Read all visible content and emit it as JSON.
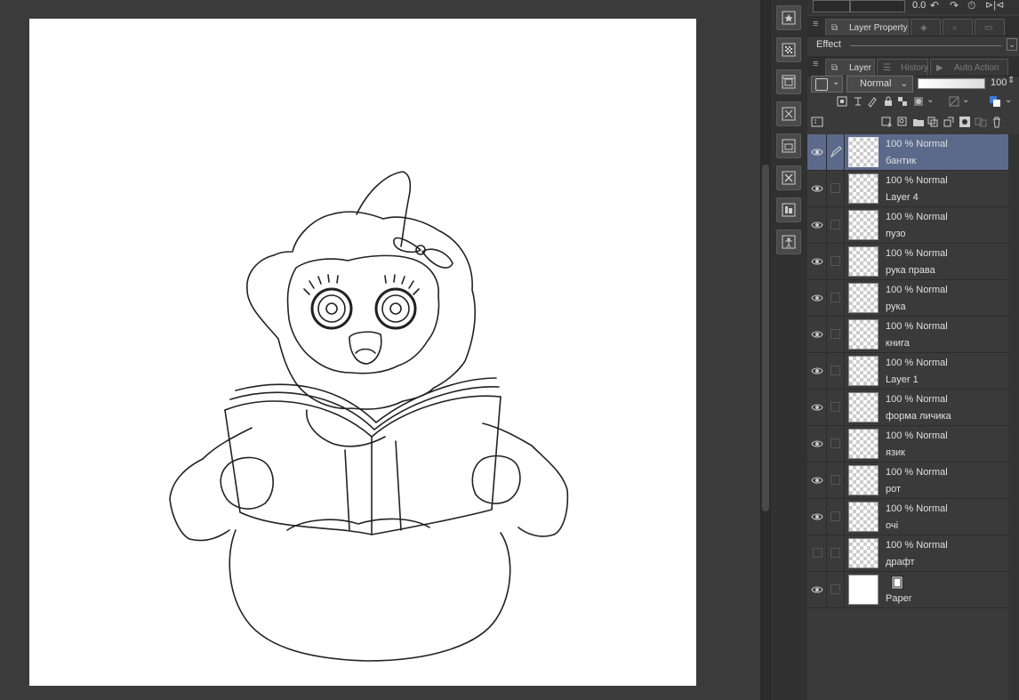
{
  "canvas": {
    "drawing": "character-reading-book-lineart"
  },
  "panel": {
    "top_value": "0.0",
    "tabs_row1": [
      {
        "label": "Layer Property",
        "active": true
      },
      {
        "label": "",
        "active": false
      },
      {
        "label": "",
        "active": false
      }
    ],
    "effect_label": "Effect",
    "tabs_row2": [
      {
        "label": "Layer",
        "active": true
      },
      {
        "label": "History",
        "active": false
      },
      {
        "label": "Auto Action",
        "active": false
      }
    ],
    "blend_mode": "Normal",
    "opacity": "100"
  },
  "layers": [
    {
      "props": "100 % Normal",
      "name": "бантик",
      "visible": true,
      "selected": true
    },
    {
      "props": "100 % Normal",
      "name": "Layer 4",
      "visible": true,
      "selected": false
    },
    {
      "props": "100 % Normal",
      "name": "пузо",
      "visible": true,
      "selected": false
    },
    {
      "props": "100 % Normal",
      "name": "рука права",
      "visible": true,
      "selected": false
    },
    {
      "props": "100 % Normal",
      "name": "рука",
      "visible": true,
      "selected": false
    },
    {
      "props": "100 % Normal",
      "name": "книга",
      "visible": true,
      "selected": false
    },
    {
      "props": "100 % Normal",
      "name": "Layer 1",
      "visible": true,
      "selected": false
    },
    {
      "props": "100 % Normal",
      "name": "форма личика",
      "visible": true,
      "selected": false
    },
    {
      "props": "100 % Normal",
      "name": "язик",
      "visible": true,
      "selected": false
    },
    {
      "props": "100 % Normal",
      "name": "рот",
      "visible": true,
      "selected": false
    },
    {
      "props": "100 % Normal",
      "name": "очі",
      "visible": true,
      "selected": false
    },
    {
      "props": "100 % Normal",
      "name": "драфт",
      "visible": false,
      "selected": false
    },
    {
      "props": "",
      "name": "Paper",
      "visible": true,
      "selected": false,
      "paper": true
    }
  ],
  "icon_strip": [
    "sub-tool-icon",
    "texture-icon",
    "navigator-icon",
    "transform-icon",
    "material-icon",
    "close-view-icon",
    "layer-search-icon",
    "figure-icon"
  ],
  "colors": {
    "selected_layer": "#5b6a8a",
    "panel_bg": "#3a3a3a",
    "canvas_bg": "#3b3b3b"
  }
}
